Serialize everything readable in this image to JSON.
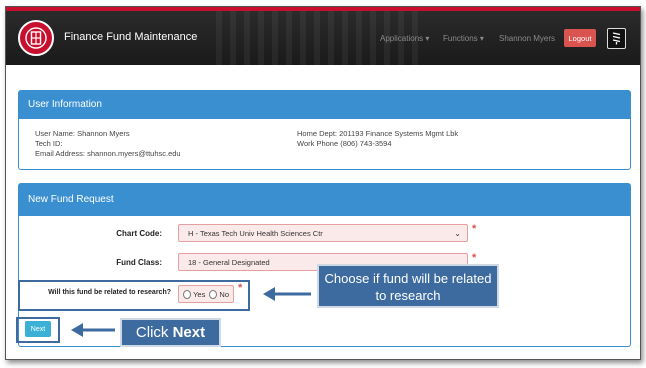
{
  "header": {
    "app_title": "Finance Fund Maintenance",
    "nav": {
      "applications": "Applications ▾",
      "functions": "Functions ▾",
      "user": "Shannon Myers"
    },
    "logout": "Logout"
  },
  "user_info": {
    "title": "User Information",
    "user_name": "User Name: Shannon Myers",
    "tech_id": "Tech ID:",
    "email": "Email Address: shannon.myers@ttuhsc.edu",
    "home_dept": "Home Dept: 201193 Finance Systems Mgmt Lbk",
    "work_phone": "Work Phone (806) 743-3594"
  },
  "fund_request": {
    "title": "New Fund Request",
    "chart_code_label": "Chart Code:",
    "chart_code_value": "H - Texas Tech Univ Health Sciences Ctr",
    "fund_class_label": "Fund Class:",
    "fund_class_value": "18 - General Designated",
    "research_label": "Will this fund be related to research?",
    "yes": "Yes",
    "no": "No",
    "required_mark": "*",
    "next": "Next"
  },
  "callouts": {
    "research": "Choose if fund will be related to research",
    "next_prefix": "Click ",
    "next_bold": "Next"
  },
  "colors": {
    "brand_red": "#c8102e",
    "panel_blue": "#3a8fd1",
    "callout_blue": "#3d6ba0",
    "next_button": "#3ab0d6"
  }
}
